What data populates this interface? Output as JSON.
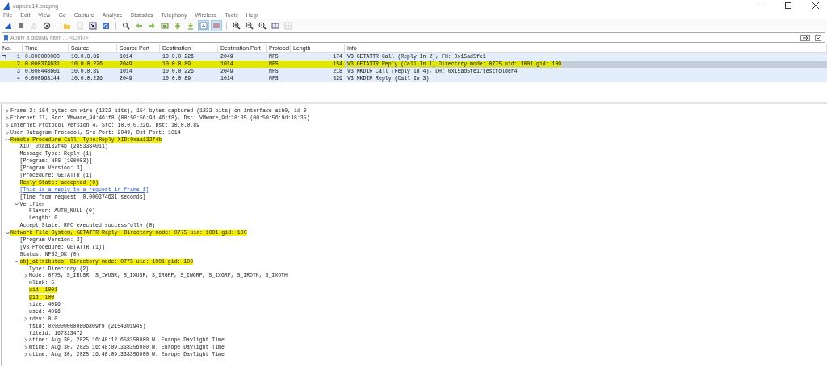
{
  "window": {
    "title": "capture14.pcapng"
  },
  "menu": [
    "File",
    "Edit",
    "View",
    "Go",
    "Capture",
    "Analyze",
    "Statistics",
    "Telephony",
    "Wireless",
    "Tools",
    "Help"
  ],
  "toolbar": [
    {
      "pressed": false,
      "disabled": false
    },
    {
      "pressed": false,
      "disabled": false
    },
    {
      "pressed": false,
      "disabled": true
    },
    {
      "pressed": false,
      "disabled": false
    },
    {
      "pressed": false,
      "disabled": false
    },
    {
      "pressed": false,
      "disabled": true
    },
    {
      "pressed": false,
      "disabled": false
    },
    {
      "pressed": false,
      "disabled": false
    },
    {
      "pressed": false,
      "disabled": false
    },
    {
      "pressed": false,
      "disabled": false
    },
    {
      "pressed": false,
      "disabled": false
    },
    {
      "pressed": false,
      "disabled": false
    },
    {
      "pressed": false,
      "disabled": false
    },
    {
      "pressed": false,
      "disabled": false
    },
    {
      "pressed": true,
      "disabled": false
    },
    {
      "pressed": true,
      "disabled": false
    },
    {
      "pressed": false,
      "disabled": false
    },
    {
      "pressed": false,
      "disabled": false
    },
    {
      "pressed": false,
      "disabled": false
    },
    {
      "pressed": false,
      "disabled": false
    },
    {
      "pressed": false,
      "disabled": true
    }
  ],
  "filter": {
    "placeholder": "Apply a display filter … <Ctrl-/>"
  },
  "packet_list": {
    "columns": [
      "No.",
      "Time",
      "Source",
      "Source Port",
      "Destination",
      "Destination Port",
      "Protocol",
      "Length",
      "Info"
    ],
    "rows": [
      {
        "cells": [
          "1",
          "0.000000000",
          "10.0.0.89",
          "1014",
          "10.0.0.226",
          "2049",
          "NFS",
          "174",
          "V3 GETATTR Call (Reply In 2), FH: 0x15ad5fe1"
        ],
        "selected": false,
        "related": true,
        "highlighted": false
      },
      {
        "cells": [
          "2",
          "0.000374631",
          "10.0.0.226",
          "2049",
          "10.0.0.89",
          "1014",
          "NFS",
          "154",
          "V3 GETATTR Reply (Call In 1)  Directory mode: 0775 uid: 1001 gid: 100"
        ],
        "selected": true,
        "related": false,
        "highlighted": true
      },
      {
        "cells": [
          "3",
          "0.000448601",
          "10.0.0.89",
          "1014",
          "10.0.0.226",
          "2049",
          "NFS",
          "218",
          "V3 MKDIR Call (Reply In 4), DH: 0x15ad5fe1/testfolder4"
        ],
        "selected": false,
        "related": false,
        "highlighted": false
      },
      {
        "cells": [
          "4",
          "0.000968144",
          "10.0.0.226",
          "2049",
          "10.0.0.89",
          "1014",
          "NFS",
          "326",
          "V3 MKDIR Reply (Call In 3)"
        ],
        "selected": false,
        "related": false,
        "highlighted": false
      }
    ]
  },
  "details": [
    {
      "text": "Frame 2: 154 bytes on wire (1232 bits), 154 bytes captured (1232 bits) on interface eth0, id 0",
      "expanded": false,
      "highlighted": false
    },
    {
      "text": "Ethernet II, Src: VMware_9d:46:f8 (00:50:56:9d:46:f8), Dst: VMware_9d:18:35 (00:50:56:9d:18:35)",
      "expanded": false,
      "highlighted": false
    },
    {
      "text": "Internet Protocol Version 4, Src: 10.0.0.226, Dst: 10.0.0.89",
      "expanded": false,
      "highlighted": false
    },
    {
      "text": "User Datagram Protocol, Src Port: 2049, Dst Port: 1014",
      "expanded": false,
      "highlighted": false
    },
    {
      "text": "Remote Procedure Call, Type:Reply XID:0xaa132f4b",
      "expanded": true,
      "highlighted": true,
      "children": [
        {
          "kind": "field",
          "text": "XID: 0xaa132f4b (2853384011)",
          "highlighted": false
        },
        {
          "kind": "field",
          "text": "Message Type: Reply (1)",
          "highlighted": false
        },
        {
          "kind": "field",
          "text": "[Program: NFS (100003)]",
          "highlighted": false
        },
        {
          "kind": "field",
          "text": "[Program Version: 3]",
          "highlighted": false
        },
        {
          "kind": "field",
          "text": "[Procedure: GETATTR (1)]",
          "highlighted": false
        },
        {
          "kind": "field",
          "text": "Reply State: accepted (0)",
          "highlighted": true
        },
        {
          "kind": "link",
          "text": "[This is a reply to a request in frame 1]",
          "highlighted": false
        },
        {
          "kind": "field",
          "text": "[Time from request: 0.000374631 seconds]",
          "highlighted": false
        },
        {
          "kind": "field",
          "text": "Verifier",
          "expanded": true,
          "highlighted": false,
          "children": [
            {
              "text": "Flavor: AUTH_NULL (0)",
              "highlighted": false
            },
            {
              "text": "Length: 0",
              "highlighted": false
            }
          ]
        },
        {
          "kind": "field",
          "text": "Accept State: RPC executed successfully (0)",
          "highlighted": false
        }
      ]
    },
    {
      "text": "Network File System, GETATTR Reply  Directory mode: 0775 uid: 1001 gid: 100",
      "expanded": true,
      "highlighted": true,
      "children": [
        {
          "text": "[Program Version: 3]",
          "highlighted": false
        },
        {
          "text": "[V3 Procedure: GETATTR (1)]",
          "highlighted": false
        },
        {
          "text": "Status: NFS3_OK (0)",
          "highlighted": false
        },
        {
          "text": "obj_attributes  Directory mode: 0775 uid: 1001 gid: 100",
          "expanded": true,
          "highlighted": true,
          "children": [
            {
              "text": "Type: Directory (2)",
              "highlighted": false
            },
            {
              "text": "Mode: 0775, S_IRUSR, S_IWUSR, S_IXUSR, S_IRGRP, S_IWGRP, S_IXGRP, S_IROTH, S_IXOTH",
              "expanded": false,
              "highlighted": false
            },
            {
              "text": "nlink: 5",
              "highlighted": false
            },
            {
              "text": "uid: 1001",
              "highlighted": true
            },
            {
              "text": "gid: 100",
              "highlighted": true
            },
            {
              "text": "size: 4096",
              "highlighted": false
            },
            {
              "text": "used: 4096",
              "highlighted": false
            },
            {
              "text": "rdev: 0,0",
              "expanded": false,
              "highlighted": false
            },
            {
              "text": "fsid: 0x00000000806809f9 (2154301945)",
              "highlighted": false
            },
            {
              "text": "fileid: 167313472",
              "highlighted": false
            },
            {
              "text": "atime: Aug 30, 2025 16:48:12.658350000 W. Europe Daylight Time",
              "expanded": false,
              "highlighted": false
            },
            {
              "text": "mtime: Aug 30, 2025 16:48:09.338356000 W. Europe Daylight Time",
              "expanded": false,
              "highlighted": false
            },
            {
              "text": "ctime: Aug 30, 2025 16:48:09.338356000 W. Europe Daylight Time",
              "expanded": false,
              "highlighted": false
            }
          ]
        }
      ]
    }
  ]
}
